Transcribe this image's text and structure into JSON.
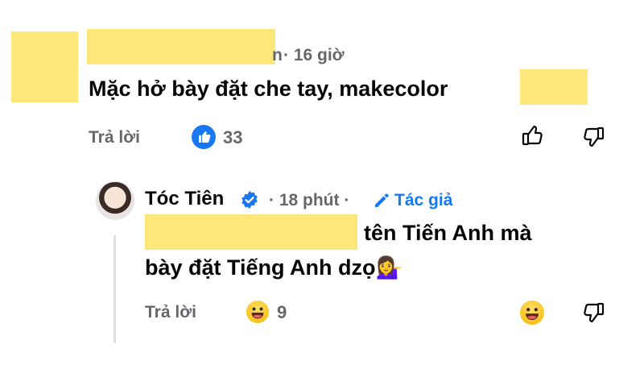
{
  "comment": {
    "time": "· 16 giờ",
    "name_tail": "n",
    "text": "Mặc hở bày đặt che tay, makecolor",
    "reply_label": "Trả lời",
    "reaction_count": "33"
  },
  "reply": {
    "author": "Tóc Tiên",
    "time": "· 18 phút ·",
    "author_badge": "Tác giả",
    "text_line1": "tên Tiến Anh mà",
    "text_line2": "bày đặt Tiếng Anh dzọ",
    "emoji": "💁‍♀️",
    "reply_label": "Trả lời",
    "reaction_count": "9"
  },
  "colors": {
    "redaction": "#fde67a",
    "like_blue": "#1877f2",
    "verified_blue": "#1877f2",
    "muted": "#65676b"
  },
  "icons": [
    "like-reaction-icon",
    "thumbs-up-icon",
    "thumbs-down-icon",
    "verified-badge-icon",
    "pencil-icon",
    "grinning-face-icon"
  ]
}
